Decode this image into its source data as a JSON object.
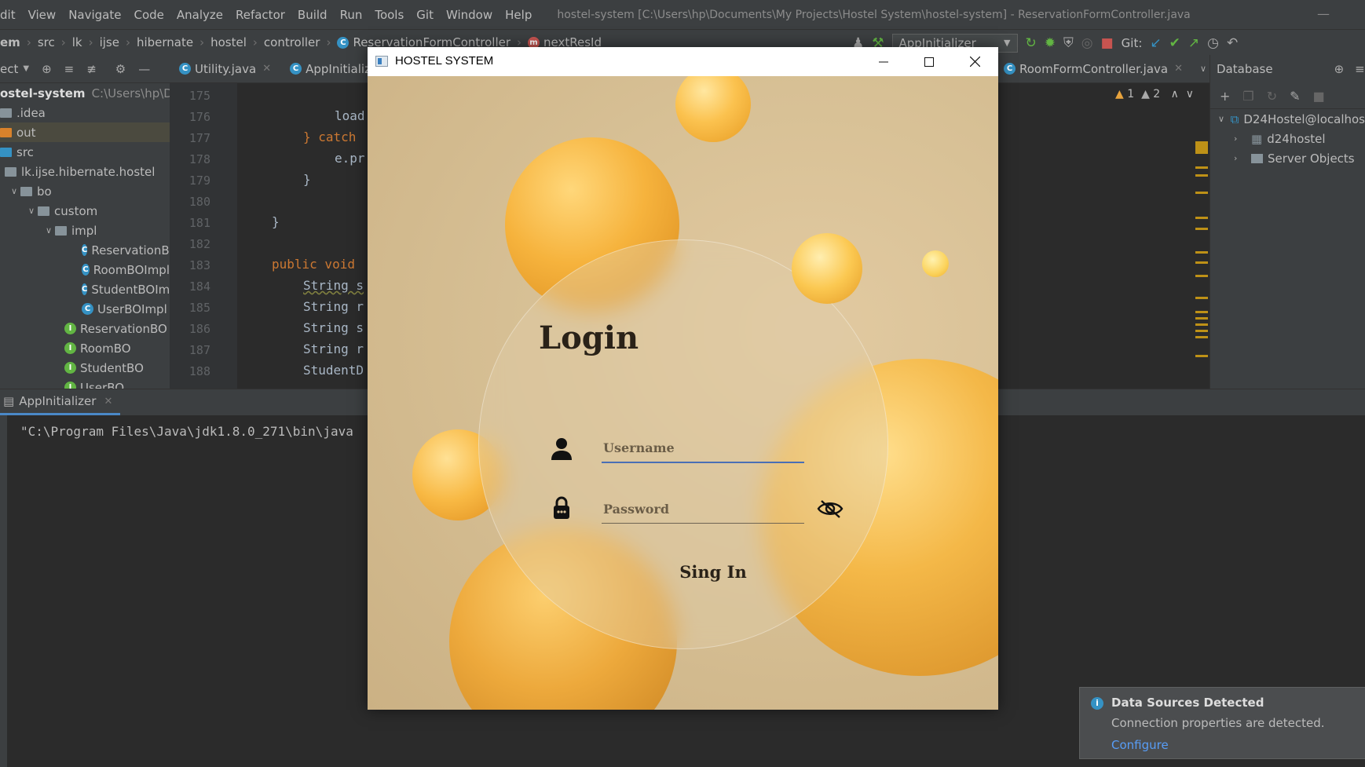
{
  "ide": {
    "menu": [
      "dit",
      "View",
      "Navigate",
      "Code",
      "Analyze",
      "Refactor",
      "Build",
      "Run",
      "Tools",
      "Git",
      "Window",
      "Help"
    ],
    "window_title": "hostel-system [C:\\Users\\hp\\Documents\\My Projects\\Hostel System\\hostel-system] - ReservationFormController.java",
    "breadcrumbs": [
      "em",
      "src",
      "lk",
      "ijse",
      "hibernate",
      "hostel",
      "controller",
      "ReservationFormController",
      "nextResId"
    ],
    "run_config": "AppInitializer",
    "git_label": "Git:"
  },
  "project": {
    "header": "ect",
    "root_name": "ostel-system",
    "root_path": "C:\\Users\\hp\\Docu",
    "items": [
      {
        "label": ".idea"
      },
      {
        "label": "out"
      },
      {
        "label": "src"
      },
      {
        "label": "lk.ijse.hibernate.hostel"
      },
      {
        "label": "bo"
      },
      {
        "label": "custom"
      },
      {
        "label": "impl"
      },
      {
        "label": "ReservationBO"
      },
      {
        "label": "RoomBOImpl"
      },
      {
        "label": "StudentBOImp"
      },
      {
        "label": "UserBOImpl"
      },
      {
        "label": "ReservationBO"
      },
      {
        "label": "RoomBO"
      },
      {
        "label": "StudentBO"
      },
      {
        "label": "UserBO"
      }
    ]
  },
  "editor": {
    "tabs": [
      "Utility.java",
      "AppInitialize",
      "RoomFormController.java"
    ],
    "line_numbers": [
      "175",
      "176",
      "177",
      "178",
      "179",
      "180",
      "181",
      "182",
      "183",
      "184",
      "185",
      "186",
      "187",
      "188"
    ],
    "lines": [
      "load",
      "} catch",
      "e.pr",
      "}",
      "}",
      "public void",
      "String s",
      "String r",
      "String s",
      "String r",
      "StudentD"
    ],
    "warnings": "1",
    "weak_warnings": "2"
  },
  "database": {
    "title": "Database",
    "connection": "D24Hostel@localhos",
    "schema": "d24hostel",
    "server_objects": "Server Objects"
  },
  "run": {
    "tab": "AppInitializer",
    "output": "\"C:\\Program Files\\Java\\jdk1.8.0_271\\bin\\java"
  },
  "notification": {
    "title": "Data Sources Detected",
    "body": "Connection properties are detected.",
    "link": "Configure"
  },
  "login_window": {
    "title": "HOSTEL SYSTEM",
    "heading": "Login",
    "username_placeholder": "Username",
    "password_placeholder": "Password",
    "signin_label": "Sing In",
    "colors": {
      "accent_underline": "#4a6fb5",
      "ball_orange": "#f4b848",
      "background": "#d7c095"
    }
  }
}
